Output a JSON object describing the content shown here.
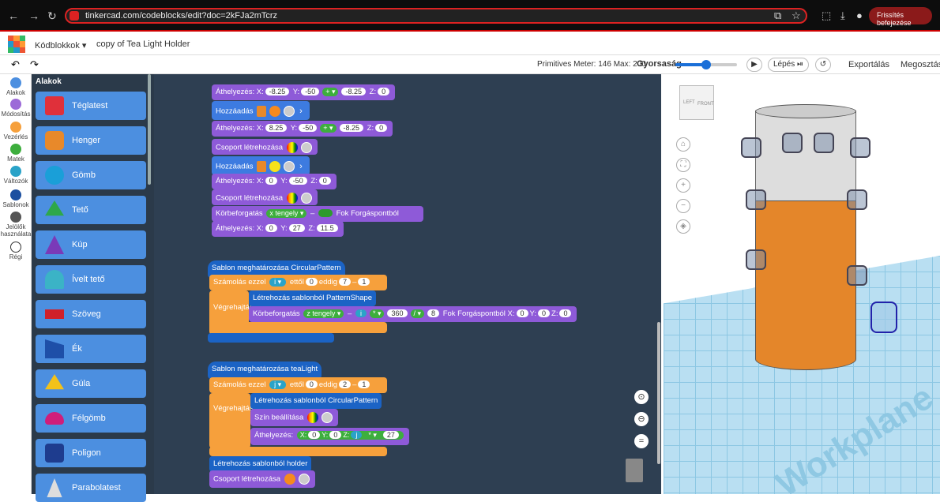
{
  "browser": {
    "url": "tinkercad.com/codeblocks/edit?doc=2kFJa2mTcrz",
    "update_label": "Frissítés befejezése"
  },
  "app": {
    "mode_label": "Kódblokkok",
    "project_title": "copy of Tea Light Holder"
  },
  "toolbar": {
    "meter": "Primitives Meter: 146 Max: 200",
    "speed_label": "Gyorsaság",
    "speed_fraction": 0.5,
    "step_label": "Lépés",
    "export_label": "Exportálás",
    "share_label": "Megosztás"
  },
  "categories": [
    {
      "label": "Alakok",
      "color": "#4c8fe0"
    },
    {
      "label": "Módosítás",
      "color": "#9c6ad8"
    },
    {
      "label": "Vezérlés",
      "color": "#f6a03c"
    },
    {
      "label": "Matek",
      "color": "#3dae3d"
    },
    {
      "label": "Változók",
      "color": "#2aa3c8"
    },
    {
      "label": "Sablonok",
      "color": "#1b4fa0"
    },
    {
      "label": "Jelölők használata",
      "color": "#555555"
    },
    {
      "label": "Régi",
      "color": "#ffffff"
    }
  ],
  "flyout": {
    "title": "Alakok",
    "shapes": [
      "Téglatest",
      "Henger",
      "Gömb",
      "Tető",
      "Kúp",
      "Ívelt tető",
      "Szöveg",
      "Ék",
      "Gúla",
      "Félgömb",
      "Poligon",
      "Parabolatest"
    ]
  },
  "code": {
    "move": "Áthelyezés:",
    "add": "Hozzáadás",
    "group": "Csoport létrehozása",
    "rotate": "Körbeforgatás",
    "deg": "Fok",
    "pivot": "Forgáspontból",
    "x": "X:",
    "y": "Y:",
    "z": "Z:",
    "v_neg825": "-8.25",
    "v_neg50": "-50",
    "v_825": "8.25",
    "v_0": "0",
    "v_27": "27",
    "v_115": "11.5",
    "v_1": "1",
    "v_7": "7",
    "v_2": "2",
    "v_360": "360",
    "v_8": "8",
    "plus": "+ ▾",
    "div": "/ ▾",
    "mul": "* ▾",
    "x_axis": "x tengely ▾",
    "z_axis": "z tengely ▾",
    "def_pattern": "Sablon meghatározása  CircularPattern",
    "def_tealight": "Sablon meghatározása  teaLight",
    "count_with": "Számolás ezzel",
    "var_i": "i ▾",
    "var_j": "j ▾",
    "from": "ettől",
    "to": "eddig",
    "by": "▾",
    "execute": "Végrehajtás",
    "create_from_pattern": "Létrehozás sablonból  PatternShape",
    "create_circular": "Létrehozás sablonból  CircularPattern",
    "create_holder": "Létrehozás sablonból  holder",
    "color_set": "Szín beállítása",
    "i": "i",
    "j": "j"
  },
  "viewport": {
    "workplane": "Workplane",
    "cube_left": "LEFT",
    "cube_front": "FRONT"
  }
}
